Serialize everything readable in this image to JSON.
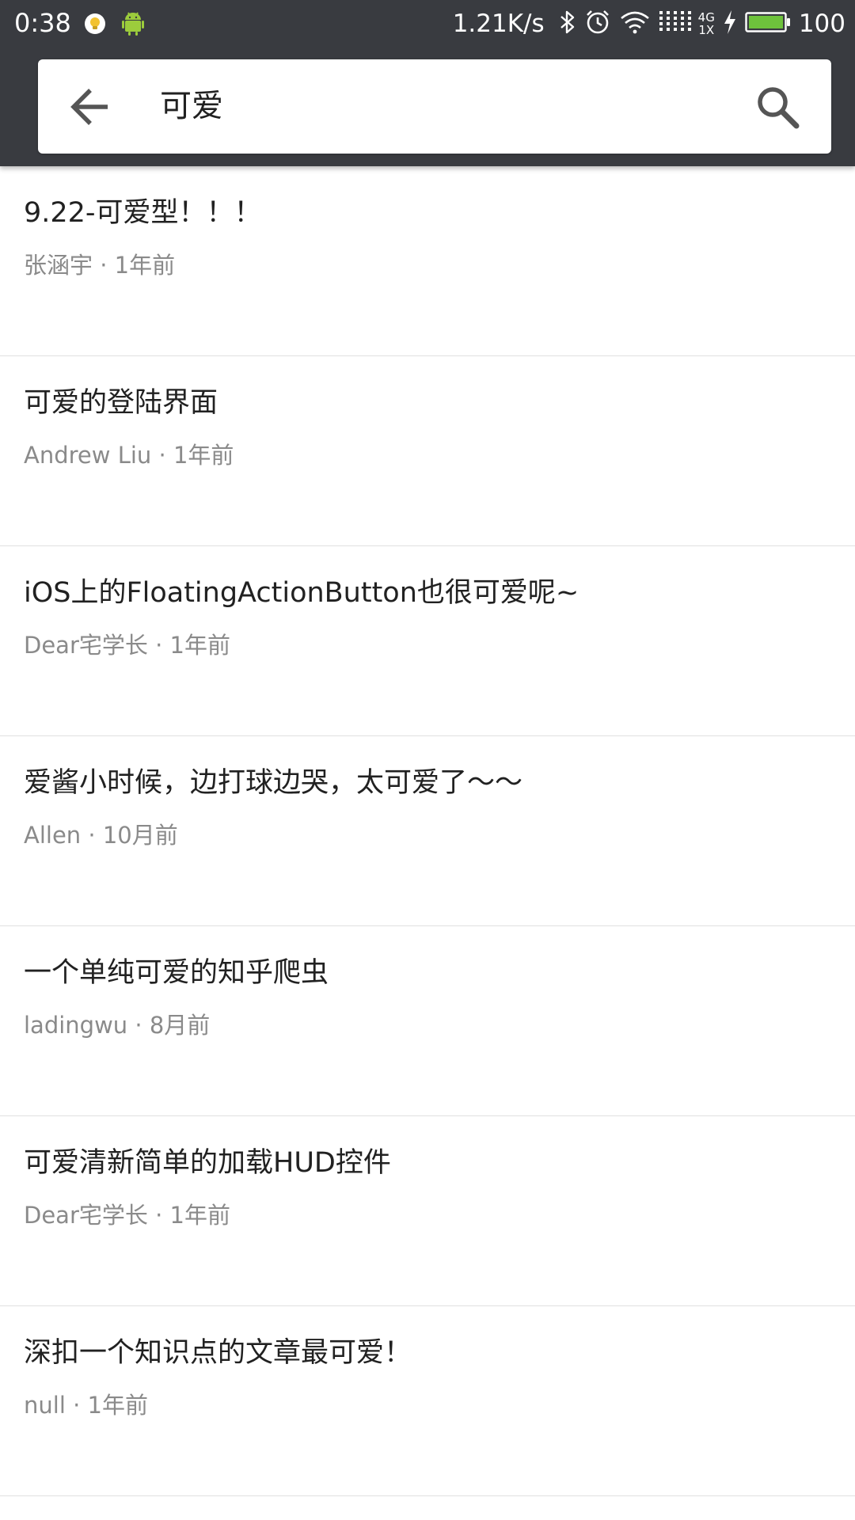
{
  "status_bar": {
    "time": "0:38",
    "network_speed": "1.21K/s",
    "network_type": "4G",
    "sim_slot": "1X",
    "battery": "100",
    "icons": [
      "bulb-notification-icon",
      "android-icon",
      "bluetooth-icon",
      "alarm-icon",
      "wifi-icon",
      "signal-icon",
      "charging-icon",
      "battery-icon"
    ]
  },
  "search": {
    "query": "可爱",
    "back_icon": "arrow-left-icon",
    "search_icon": "magnifier-icon"
  },
  "results": [
    {
      "title": "9.22-可爱型！！！",
      "author": "张涵宇",
      "time": "1年前"
    },
    {
      "title": "可爱的登陆界面",
      "author": "Andrew Liu",
      "time": "1年前"
    },
    {
      "title": "iOS上的FloatingActionButton也很可爱呢~",
      "author": "Dear宅学长",
      "time": "1年前"
    },
    {
      "title": "爱酱小时候，边打球边哭，太可爱了～～",
      "author": "Allen",
      "time": "10月前"
    },
    {
      "title": "一个单纯可爱的知乎爬虫",
      "author": "ladingwu",
      "time": "8月前"
    },
    {
      "title": "可爱清新简单的加载HUD控件",
      "author": "Dear宅学长",
      "time": "1年前"
    },
    {
      "title": "深扣一个知识点的文章最可爱！",
      "author": "null",
      "time": "1年前"
    }
  ],
  "colors": {
    "toolbar": "#393b40",
    "battery_fill": "#6ec23c",
    "android_green": "#9ccc3c",
    "meta_text": "#8a8a8a"
  }
}
